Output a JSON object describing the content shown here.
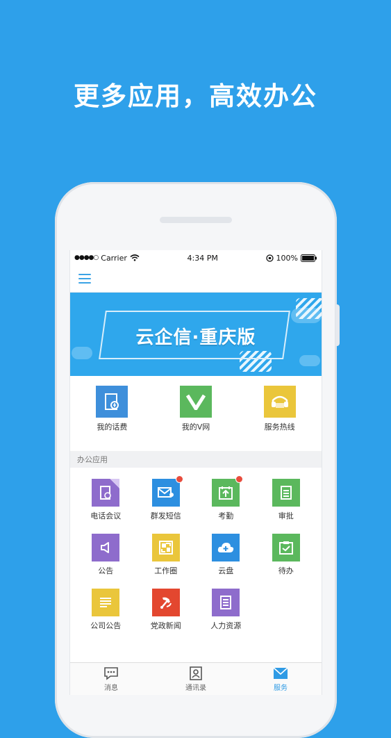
{
  "headline": "更多应用，高效办公",
  "status_bar": {
    "carrier": "Carrier",
    "time": "4:34 PM",
    "battery": "100%"
  },
  "banner": {
    "title": "云企信·重庆版"
  },
  "quick_apps": [
    {
      "label": "我的话费",
      "color": "#3e8fdb",
      "icon": "phone-bill-icon"
    },
    {
      "label": "我的V网",
      "color": "#5bb85d",
      "icon": "v-network-icon"
    },
    {
      "label": "服务热线",
      "color": "#eac63b",
      "icon": "hotline-icon"
    }
  ],
  "section_title": "办公应用",
  "office_apps": [
    {
      "label": "电话会议",
      "color": "#8e6ccc",
      "icon": "conference-call-icon",
      "badge": false
    },
    {
      "label": "群发短信",
      "color": "#2d8fe0",
      "icon": "group-sms-icon",
      "badge": true
    },
    {
      "label": "考勤",
      "color": "#5bb85d",
      "icon": "attendance-icon",
      "badge": true
    },
    {
      "label": "审批",
      "color": "#5bb85d",
      "icon": "approval-icon",
      "badge": false
    },
    {
      "label": "公告",
      "color": "#8e6ccc",
      "icon": "announcement-icon",
      "badge": false
    },
    {
      "label": "工作圈",
      "color": "#eac63b",
      "icon": "work-circle-icon",
      "badge": false
    },
    {
      "label": "云盘",
      "color": "#2d8fe0",
      "icon": "cloud-drive-icon",
      "badge": false
    },
    {
      "label": "待办",
      "color": "#5bb85d",
      "icon": "todo-icon",
      "badge": false
    },
    {
      "label": "公司公告",
      "color": "#eac63b",
      "icon": "company-notice-icon",
      "badge": false
    },
    {
      "label": "党政新闻",
      "color": "#e3472f",
      "icon": "party-news-icon",
      "badge": false
    },
    {
      "label": "人力资源",
      "color": "#8e6ccc",
      "icon": "hr-icon",
      "badge": false
    }
  ],
  "tabs": [
    {
      "label": "消息",
      "icon": "message-icon",
      "active": false
    },
    {
      "label": "通讯录",
      "icon": "contacts-icon",
      "active": false
    },
    {
      "label": "服务",
      "icon": "service-icon",
      "active": true
    }
  ]
}
